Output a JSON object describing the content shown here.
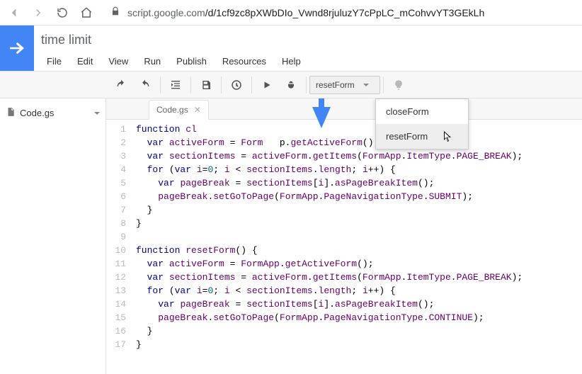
{
  "browser": {
    "url_host": "script.google.com",
    "url_path": "/d/1cf9zc8pXWbDIo_Vwnd8rjuluzY7cPpLC_mCohvvYT3GEkLh"
  },
  "header": {
    "title": "time limit",
    "menus": {
      "file": "File",
      "edit": "Edit",
      "view": "View",
      "run": "Run",
      "publish": "Publish",
      "resources": "Resources",
      "help": "Help"
    }
  },
  "toolbar": {
    "function_selected": "resetForm",
    "dropdown": {
      "item0": "closeForm",
      "item1": "resetForm"
    }
  },
  "sidebar": {
    "file0": "Code.gs"
  },
  "tabs": {
    "tab0": "Code.gs"
  },
  "gutter": {
    "l1": "1",
    "l2": "2",
    "l3": "3",
    "l4": "4",
    "l5": "5",
    "l6": "6",
    "l7": "7",
    "l8": "8",
    "l9": "9",
    "l10": "10",
    "l11": "11",
    "l12": "12",
    "l13": "13",
    "l14": "14",
    "l15": "15",
    "l16": "16",
    "l17": "17"
  },
  "code": {
    "t_function": "function",
    "t_var": "var",
    "t_for": "for",
    "fn_close": "cl",
    "fn_reset": "resetForm",
    "id_activeForm": "activeForm",
    "id_sectionItems": "sectionItems",
    "id_i": "i",
    "id_pageBreak": "pageBreak",
    "id_FormApp": "FormApp",
    "id_Form": "Form",
    "m_getActiveForm": "getActiveForm",
    "m_getItems": "getItems",
    "m_ItemType": "ItemType",
    "m_PAGE_BREAK": "PAGE_BREAK",
    "m_length": "length",
    "m_asPageBreakItem": "asPageBreakItem",
    "m_setGoToPage": "setGoToPage",
    "m_PageNavigationType": "PageNavigationType",
    "m_SUBMIT": "SUBMIT",
    "m_CONTINUE": "CONTINUE",
    "txt_p": "p.",
    "num_0": "0",
    "s_op": "()",
    "s_sc": ";",
    "s_lb": "{",
    "s_rb": "}",
    "s_opp": "() {",
    "s_eq": " = ",
    "s_dot": ".",
    "s_lpar": "(",
    "s_rpar": ")",
    "s_fhead1": " (",
    "s_fhead2": "=",
    "s_fhead3": "; ",
    "s_fhead4": " < ",
    "s_fhead5": "++) {",
    "s_idx_l": "[",
    "s_idx_r": "]."
  }
}
